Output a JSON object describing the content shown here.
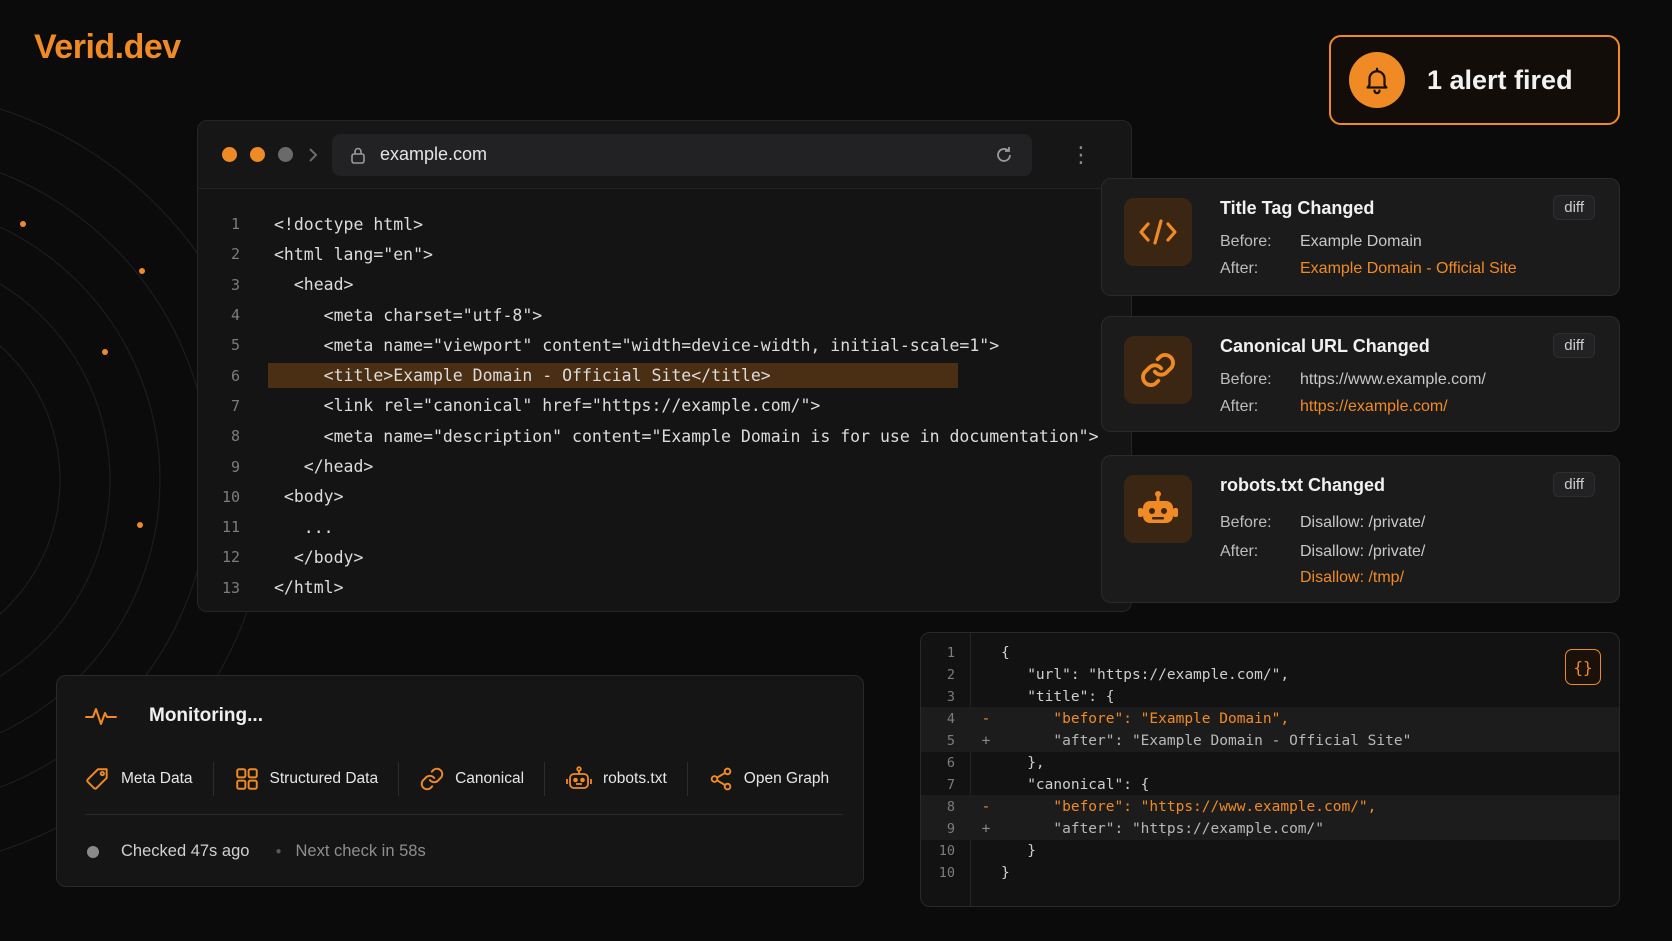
{
  "brand": {
    "name": "Verid.dev",
    "accent": "#f08a24"
  },
  "alert": {
    "text": "1 alert fired",
    "icon": "bell-icon"
  },
  "browser": {
    "url": "example.com",
    "lines": [
      {
        "n": "1",
        "code": "<!doctype html>"
      },
      {
        "n": "2",
        "code": "<html lang=\"en\">"
      },
      {
        "n": "3",
        "code": "  <head>"
      },
      {
        "n": "4",
        "code": "     <meta charset=\"utf-8\">"
      },
      {
        "n": "5",
        "code": "     <meta name=\"viewport\" content=\"width=device-width, initial-scale=1\">"
      },
      {
        "n": "6",
        "code": "     <title>Example Domain - Official Site</title>",
        "highlight": true
      },
      {
        "n": "7",
        "code": "     <link rel=\"canonical\" href=\"https://example.com/\">"
      },
      {
        "n": "8",
        "code": "     <meta name=\"description\" content=\"Example Domain is for use in documentation\">"
      },
      {
        "n": "9",
        "code": "   </head>"
      },
      {
        "n": "10",
        "code": " <body>"
      },
      {
        "n": "11",
        "code": "   ..."
      },
      {
        "n": "12",
        "code": "  </body>"
      },
      {
        "n": "13",
        "code": "</html>"
      }
    ]
  },
  "changes": [
    {
      "title": "Title Tag Changed",
      "diff": "diff",
      "before_label": "Before:",
      "before": "Example Domain",
      "after_label": "After:",
      "after": "Example Domain - Official Site",
      "icon": "code-icon"
    },
    {
      "title": "Canonical URL Changed",
      "diff": "diff",
      "before_label": "Before:",
      "before": "https://www.example.com/",
      "after_label": "After:",
      "after": "https://example.com/",
      "icon": "link-icon"
    },
    {
      "title": "robots.txt Changed",
      "diff": "diff",
      "before_label": "Before:",
      "before": "Disallow: /private/",
      "after_label": "After:",
      "after": "Disallow: /private/",
      "after_added": "Disallow: /tmp/",
      "icon": "robot-icon"
    }
  ],
  "monitoring": {
    "title": "Monitoring...",
    "chips": [
      {
        "label": "Meta Data",
        "icon": "tag-icon"
      },
      {
        "label": "Structured Data",
        "icon": "grid-icon"
      },
      {
        "label": "Canonical",
        "icon": "link-icon"
      },
      {
        "label": "robots.txt",
        "icon": "robot-icon"
      },
      {
        "label": "Open Graph",
        "icon": "share-icon"
      }
    ],
    "checked": "Checked 47s ago",
    "next": "Next check in 58s"
  },
  "json_diff": {
    "lines": [
      {
        "n": "1",
        "mark": "",
        "text": "{"
      },
      {
        "n": "2",
        "mark": "",
        "text": "   \"url\": \"https://example.com/\","
      },
      {
        "n": "3",
        "mark": "",
        "text": "   \"title\": {"
      },
      {
        "n": "4",
        "mark": "-",
        "text": "      \"before\": \"Example Domain\",",
        "type": "del"
      },
      {
        "n": "5",
        "mark": "+",
        "text": "      \"after\": \"Example Domain - Official Site\"",
        "type": "add"
      },
      {
        "n": "6",
        "mark": "",
        "text": "   },"
      },
      {
        "n": "7",
        "mark": "",
        "text": "   \"canonical\": {"
      },
      {
        "n": "8",
        "mark": "-",
        "text": "      \"before\": \"https://www.example.com/\",",
        "type": "del"
      },
      {
        "n": "9",
        "mark": "+",
        "text": "      \"after\": \"https://example.com/\"",
        "type": "add"
      },
      {
        "n": "10",
        "mark": "",
        "text": "   }"
      },
      {
        "n": "10",
        "mark": "",
        "text": "}"
      }
    ],
    "braces_label": "{}"
  }
}
